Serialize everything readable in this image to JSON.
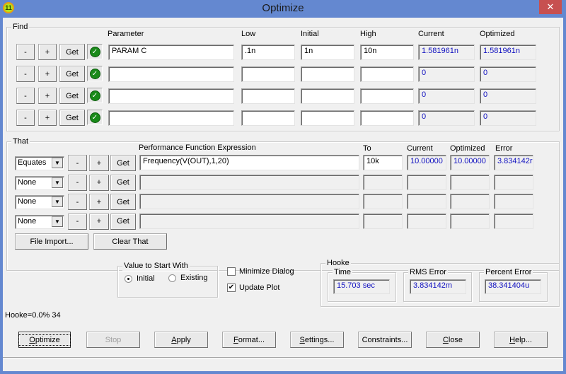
{
  "window": {
    "title": "Optimize",
    "app_icon": "app-badge-11",
    "app_icon_text": "11",
    "close_glyph": "✕"
  },
  "find": {
    "label": "Find",
    "columns": {
      "parameter": "Parameter",
      "low": "Low",
      "initial": "Initial",
      "high": "High",
      "current": "Current",
      "optimized": "Optimized"
    },
    "buttons": {
      "minus": "-",
      "plus": "+",
      "get": "Get"
    },
    "check_glyph": "✓",
    "rows": [
      {
        "parameter": "PARAM C",
        "low": ".1n",
        "initial": "1n",
        "high": "10n",
        "current": "1.581961n",
        "optimized": "1.581961n",
        "enabled": true
      },
      {
        "parameter": "",
        "low": "",
        "initial": "",
        "high": "",
        "current": "0",
        "optimized": "0",
        "enabled": true
      },
      {
        "parameter": "",
        "low": "",
        "initial": "",
        "high": "",
        "current": "0",
        "optimized": "0",
        "enabled": true
      },
      {
        "parameter": "",
        "low": "",
        "initial": "",
        "high": "",
        "current": "0",
        "optimized": "0",
        "enabled": true
      }
    ]
  },
  "that": {
    "label": "That",
    "columns": {
      "expression": "Performance Function Expression",
      "to": "To",
      "current": "Current",
      "optimized": "Optimized",
      "error": "Error"
    },
    "buttons": {
      "minus": "-",
      "plus": "+",
      "get": "Get"
    },
    "dropdown_arrow": "▼",
    "rows": [
      {
        "mode": "Equates",
        "expression": "Frequency(V(OUT),1,20)",
        "to": "10k",
        "current": "10.00000",
        "optimized": "10.00000",
        "error": "3.834142r"
      },
      {
        "mode": "None",
        "expression": "",
        "to": "",
        "current": "",
        "optimized": "",
        "error": ""
      },
      {
        "mode": "None",
        "expression": "",
        "to": "",
        "current": "",
        "optimized": "",
        "error": ""
      },
      {
        "mode": "None",
        "expression": "",
        "to": "",
        "current": "",
        "optimized": "",
        "error": ""
      }
    ],
    "file_import": "File Import...",
    "clear_that": "Clear That"
  },
  "start_with": {
    "label": "Value to Start With",
    "options": [
      {
        "label": "Initial",
        "selected": true
      },
      {
        "label": "Existing",
        "selected": false
      }
    ]
  },
  "options": {
    "minimize_dialog": {
      "label": "Minimize Dialog",
      "checked": false
    },
    "update_plot": {
      "label": "Update Plot",
      "checked": true
    },
    "check_glyph": "✔"
  },
  "hooke": {
    "label": "Hooke",
    "time": {
      "label": "Time",
      "value": "15.703 sec"
    },
    "rms_error": {
      "label": "RMS Error",
      "value": "3.834142m"
    },
    "percent_error": {
      "label": "Percent Error",
      "value": "38.341404u"
    }
  },
  "status": "Hooke=0.0% 34",
  "buttons": {
    "optimize": {
      "pre": "",
      "key": "O",
      "post": "ptimize"
    },
    "stop": "Stop",
    "apply": {
      "pre": "",
      "key": "A",
      "post": "pply"
    },
    "format": {
      "pre": "",
      "key": "F",
      "post": "ormat..."
    },
    "settings": {
      "pre": "",
      "key": "S",
      "post": "ettings..."
    },
    "constraints": "Constraints...",
    "close": {
      "pre": "",
      "key": "C",
      "post": "lose"
    },
    "help": {
      "pre": "",
      "key": "H",
      "post": "elp..."
    }
  }
}
